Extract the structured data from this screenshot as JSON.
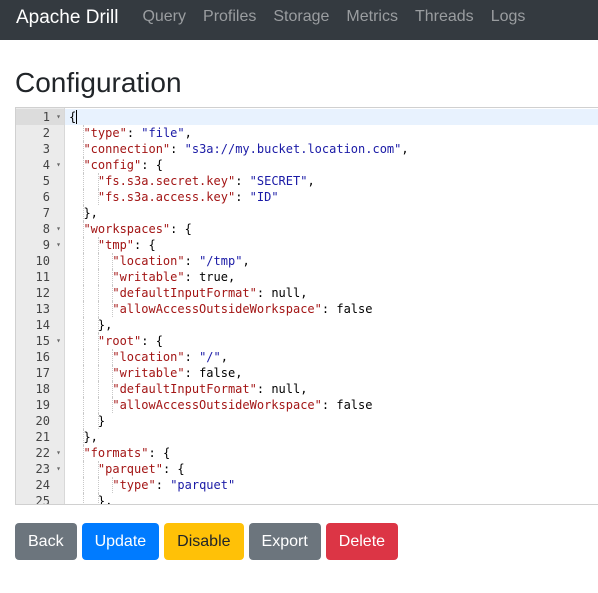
{
  "navbar": {
    "brand": "Apache Drill",
    "items": [
      "Query",
      "Profiles",
      "Storage",
      "Metrics",
      "Threads",
      "Logs"
    ]
  },
  "page": {
    "title": "Configuration"
  },
  "editor": {
    "active_line": 1,
    "lines": [
      {
        "num": "1",
        "fold": true,
        "text": "{"
      },
      {
        "num": "2",
        "fold": false,
        "text": "  \"type\": \"file\","
      },
      {
        "num": "3",
        "fold": false,
        "text": "  \"connection\": \"s3a://my.bucket.location.com\","
      },
      {
        "num": "4",
        "fold": true,
        "text": "  \"config\": {"
      },
      {
        "num": "5",
        "fold": false,
        "text": "    \"fs.s3a.secret.key\": \"SECRET\","
      },
      {
        "num": "6",
        "fold": false,
        "text": "    \"fs.s3a.access.key\": \"ID\""
      },
      {
        "num": "7",
        "fold": false,
        "text": "  },"
      },
      {
        "num": "8",
        "fold": true,
        "text": "  \"workspaces\": {"
      },
      {
        "num": "9",
        "fold": true,
        "text": "    \"tmp\": {"
      },
      {
        "num": "10",
        "fold": false,
        "text": "      \"location\": \"/tmp\","
      },
      {
        "num": "11",
        "fold": false,
        "text": "      \"writable\": true,"
      },
      {
        "num": "12",
        "fold": false,
        "text": "      \"defaultInputFormat\": null,"
      },
      {
        "num": "13",
        "fold": false,
        "text": "      \"allowAccessOutsideWorkspace\": false"
      },
      {
        "num": "14",
        "fold": false,
        "text": "    },"
      },
      {
        "num": "15",
        "fold": true,
        "text": "    \"root\": {"
      },
      {
        "num": "16",
        "fold": false,
        "text": "      \"location\": \"/\","
      },
      {
        "num": "17",
        "fold": false,
        "text": "      \"writable\": false,"
      },
      {
        "num": "18",
        "fold": false,
        "text": "      \"defaultInputFormat\": null,"
      },
      {
        "num": "19",
        "fold": false,
        "text": "      \"allowAccessOutsideWorkspace\": false"
      },
      {
        "num": "20",
        "fold": false,
        "text": "    }"
      },
      {
        "num": "21",
        "fold": false,
        "text": "  },"
      },
      {
        "num": "22",
        "fold": true,
        "text": "  \"formats\": {"
      },
      {
        "num": "23",
        "fold": true,
        "text": "    \"parquet\": {"
      },
      {
        "num": "24",
        "fold": false,
        "text": "      \"type\": \"parquet\""
      },
      {
        "num": "25",
        "fold": false,
        "text": "    },"
      }
    ]
  },
  "buttons": [
    {
      "name": "back-button",
      "label": "Back",
      "bg": "#6c757d",
      "fg": "#ffffff"
    },
    {
      "name": "update-button",
      "label": "Update",
      "bg": "#007bff",
      "fg": "#ffffff"
    },
    {
      "name": "disable-button",
      "label": "Disable",
      "bg": "#ffc107",
      "fg": "#212529"
    },
    {
      "name": "export-button",
      "label": "Export",
      "bg": "#6c757d",
      "fg": "#ffffff"
    },
    {
      "name": "delete-button",
      "label": "Delete",
      "bg": "#dc3545",
      "fg": "#ffffff"
    }
  ],
  "colors": {
    "navbar_bg": "#343a40",
    "nav_link": "#9a9da0"
  }
}
